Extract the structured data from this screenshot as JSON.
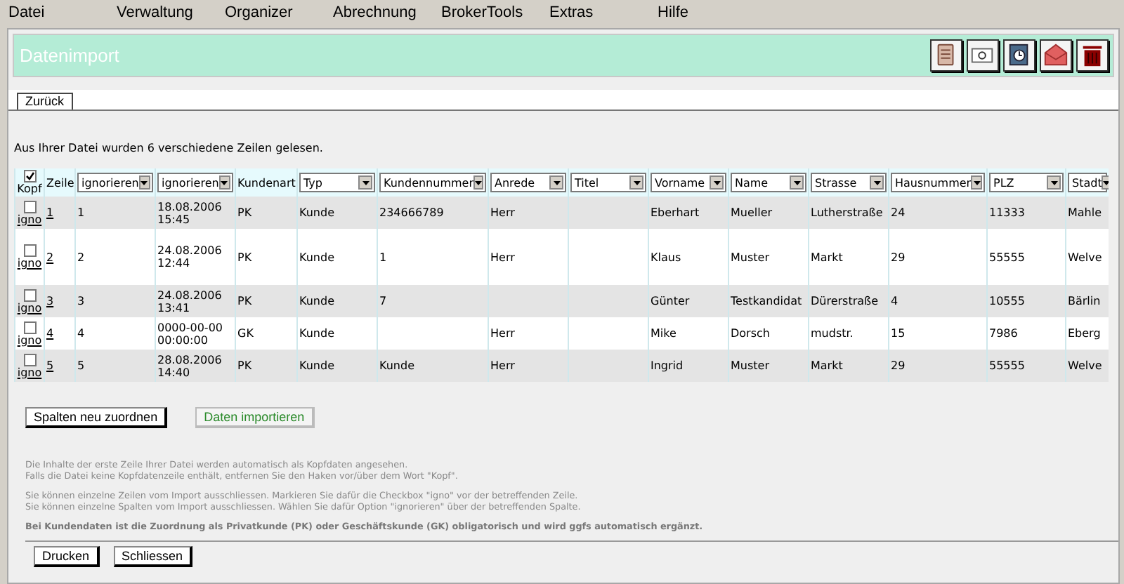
{
  "menu": [
    "Datei",
    "Verwaltung",
    "Organizer",
    "Abrechnung",
    "BrokerTools",
    "Extras",
    "Hilfe"
  ],
  "header": {
    "title": "Datenimport"
  },
  "tabs": [
    {
      "label": "Zurück",
      "selected": true
    }
  ],
  "intro": "Aus Ihrer Datei wurden 6 verschiedene Zeilen gelesen.",
  "table": {
    "header_checkbox": {
      "label": "Kopf",
      "checked": true
    },
    "columns": [
      {
        "kind": "text",
        "label": "Zeile"
      },
      {
        "kind": "select",
        "label": "ignorieren"
      },
      {
        "kind": "select",
        "label": "ignorieren"
      },
      {
        "kind": "text",
        "label": "Kundenart"
      },
      {
        "kind": "select",
        "label": "Typ"
      },
      {
        "kind": "select",
        "label": "Kundennummer"
      },
      {
        "kind": "select",
        "label": "Anrede"
      },
      {
        "kind": "select",
        "label": "Titel"
      },
      {
        "kind": "select",
        "label": "Vorname"
      },
      {
        "kind": "select",
        "label": "Name"
      },
      {
        "kind": "select",
        "label": "Strasse"
      },
      {
        "kind": "select",
        "label": "Hausnummer"
      },
      {
        "kind": "select",
        "label": "PLZ"
      },
      {
        "kind": "select",
        "label": "Stadt"
      }
    ],
    "rows": [
      {
        "ignored": false,
        "ignore_label": "igno",
        "cells": [
          "1",
          "1",
          "18.08.2006 15:45",
          "PK",
          "Kunde",
          "234666789",
          "Herr",
          null,
          "Eberhart",
          "Mueller",
          "Lutherstraße",
          "24",
          "11333",
          "Mahle"
        ]
      },
      {
        "ignored": false,
        "ignore_label": "igno",
        "cells": [
          "2",
          "2",
          "24.08.2006 12:44",
          "PK",
          "Kunde",
          "1",
          "Herr",
          null,
          "Klaus",
          "Muster",
          "Markt",
          "29",
          "55555",
          "Welve"
        ]
      },
      {
        "ignored": false,
        "ignore_label": "igno",
        "cells": [
          "3",
          "3",
          "24.08.2006 13:41",
          "PK",
          "Kunde",
          "7",
          null,
          null,
          "Günter",
          "Testkandidat",
          "Dürerstraße",
          "4",
          "10555",
          "Bärlin"
        ]
      },
      {
        "ignored": false,
        "ignore_label": "igno",
        "cells": [
          "4",
          "4",
          "0000-00-00 00:00:00",
          "GK",
          "Kunde",
          null,
          "Herr",
          null,
          "Mike",
          "Dorsch",
          "mudstr.",
          "15",
          "7986",
          "Eberg"
        ]
      },
      {
        "ignored": false,
        "ignore_label": "igno",
        "cells": [
          "5",
          "5",
          "28.08.2006 14:40",
          "PK",
          "Kunde",
          "Kunde",
          "Herr",
          null,
          "Ingrid",
          "Muster",
          "Markt",
          "29",
          "55555",
          "Welve"
        ]
      }
    ]
  },
  "actions": [
    {
      "kind": "plain",
      "label": "Spalten neu zuordnen"
    },
    {
      "kind": "primary",
      "label": "Daten importieren"
    }
  ],
  "notes": [
    {
      "kind": "normal",
      "lines": [
        "Die Inhalte der erste Zeile Ihrer Datei werden automatisch als Kopfdaten angesehen.",
        "Falls die Datei keine Kopfdatenzeile enthält, entfernen Sie den Haken vor/über dem Wort \"Kopf\"."
      ]
    },
    {
      "kind": "normal",
      "lines": [
        "Sie können einzelne Zeilen vom Import ausschliessen. Markieren Sie dafür die Checkbox \"igno\" vor der betreffenden Zeile.",
        "Sie können einzelne Spalten vom Import ausschliessen. Wählen Sie dafür Option \"ignorieren\" über der betreffenden Spalte."
      ]
    },
    {
      "kind": "bold",
      "lines": [
        "Bei Kundendaten ist die Zuordnung als Privatkunde (PK) oder Geschäftskunde (GK) obligatorisch und wird ggfs automatisch ergänzt."
      ]
    }
  ],
  "footer_buttons": [
    "Drucken",
    "Schliessen"
  ]
}
